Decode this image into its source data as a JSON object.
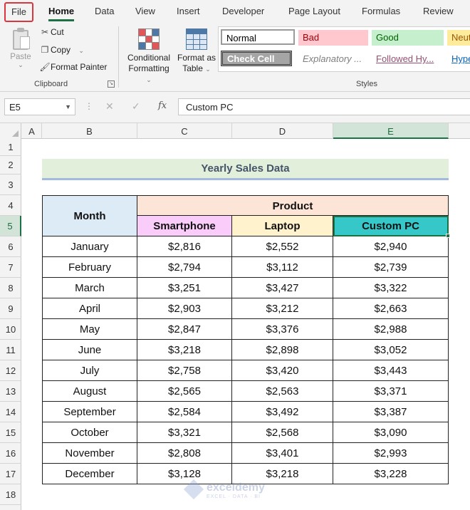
{
  "ribbon_tabs": {
    "file": "File",
    "home": "Home",
    "data": "Data",
    "view": "View",
    "insert": "Insert",
    "developer": "Developer",
    "page_layout": "Page Layout",
    "formulas": "Formulas",
    "review": "Review"
  },
  "clipboard": {
    "paste": "Paste",
    "cut": "Cut",
    "copy": "Copy",
    "format_painter": "Format Painter",
    "group_label": "Clipboard"
  },
  "styles_group": {
    "conditional_formatting_line1": "Conditional",
    "conditional_formatting_line2": "Formatting",
    "format_as_table_line1": "Format as",
    "format_as_table_line2": "Table",
    "gallery": {
      "normal": "Normal",
      "bad": "Bad",
      "good": "Good",
      "neutral": "Neut",
      "check_cell": "Check Cell",
      "explanatory": "Explanatory ...",
      "followed_hyperlink": "Followed Hy...",
      "hyperlink": "Hype"
    },
    "group_label": "Styles"
  },
  "formula_bar": {
    "name_box": "E5",
    "fx": "fx",
    "content": "Custom PC"
  },
  "columns": [
    "A",
    "B",
    "C",
    "D",
    "E"
  ],
  "rows": [
    "1",
    "2",
    "3",
    "4",
    "5",
    "6",
    "7",
    "8",
    "9",
    "10",
    "11",
    "12",
    "13",
    "14",
    "15",
    "16",
    "17",
    "18"
  ],
  "sheet": {
    "title": "Yearly Sales Data",
    "month_header": "Month",
    "product_header": "Product",
    "product_columns": [
      "Smartphone",
      "Laptop",
      "Custom PC"
    ],
    "header_colors": [
      "#f9ccf9",
      "#fff2cc",
      "#36c8c8"
    ],
    "data": [
      [
        "January",
        "$2,816",
        "$2,552",
        "$2,940"
      ],
      [
        "February",
        "$2,794",
        "$3,112",
        "$2,739"
      ],
      [
        "March",
        "$3,251",
        "$3,427",
        "$3,322"
      ],
      [
        "April",
        "$2,903",
        "$3,212",
        "$2,663"
      ],
      [
        "May",
        "$2,847",
        "$3,376",
        "$2,988"
      ],
      [
        "June",
        "$3,218",
        "$2,898",
        "$3,052"
      ],
      [
        "July",
        "$2,758",
        "$3,420",
        "$3,443"
      ],
      [
        "August",
        "$2,565",
        "$2,563",
        "$3,371"
      ],
      [
        "September",
        "$2,584",
        "$3,492",
        "$3,387"
      ],
      [
        "October",
        "$3,321",
        "$2,568",
        "$3,090"
      ],
      [
        "November",
        "$2,808",
        "$3,401",
        "$2,993"
      ],
      [
        "December",
        "$3,128",
        "$3,218",
        "$3,228"
      ]
    ]
  },
  "watermark": {
    "name": "exceldemy",
    "tagline": "EXCEL · DATA · BI"
  }
}
